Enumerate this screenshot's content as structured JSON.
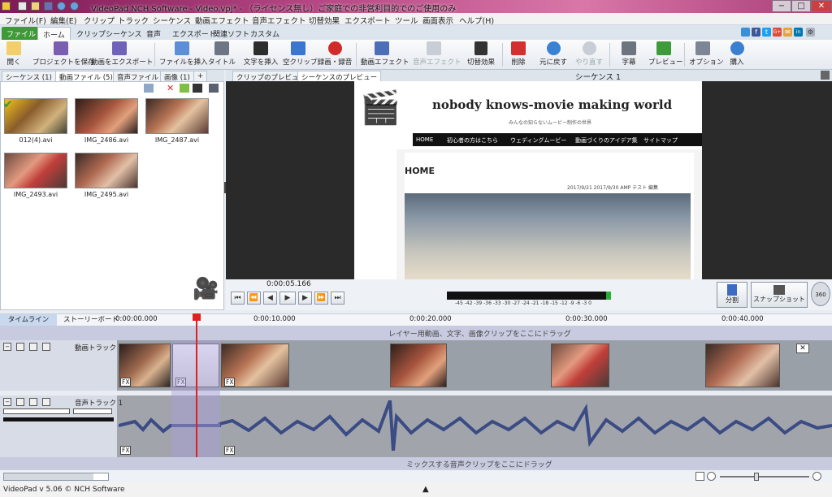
{
  "window": {
    "title": "VideoPad NCH Software - Video.vpj* - （ライセンス無し）ご家庭での非営利目的でのご使用のみ",
    "controls": [
      "−",
      "□",
      "✕"
    ]
  },
  "menu": [
    "ファイル(F)",
    "編集(E)",
    "クリップ",
    "トラック",
    "シーケンス",
    "動画エフェクト",
    "音声エフェクト",
    "切替効果",
    "エクスポート",
    "ツール",
    "画面表示",
    "ヘルプ(H)"
  ],
  "ribbon_tabs": [
    "ファイル",
    "ホーム",
    "クリップ",
    "シーケンス",
    "音声",
    "エクスポート",
    "関連ソフト",
    "カスタム"
  ],
  "social": [
    "f",
    "t",
    "G+",
    "✉",
    "in",
    "⚙"
  ],
  "toolbar": [
    "開く",
    "プロジェクトを保存",
    "動画をエクスポート",
    "ファイルを挿入",
    "タイトル",
    "文字を挿入",
    "空クリップ",
    "録画・録音",
    "動画エフェクト",
    "音声エフェクト",
    "切替効果",
    "削除",
    "元に戻す",
    "やり直す",
    "字幕",
    "プレビュー",
    "オプション",
    "購入"
  ],
  "colors": {
    "accent_green": "#3d9a37",
    "playhead": "#e02020",
    "waveform": "#3b4b84"
  },
  "bin": {
    "tabs": [
      {
        "label": "シーケンス",
        "count": "(1)"
      },
      {
        "label": "動画ファイル",
        "count": "(5)"
      },
      {
        "label": "音声ファイル",
        "count": ""
      },
      {
        "label": "画像",
        "count": "(1)"
      },
      {
        "label": "+",
        "count": ""
      }
    ],
    "files": [
      "012(4).avi",
      "IMG_2486.avi",
      "IMG_2487.avi",
      "IMG_2493.avi",
      "IMG_2495.avi"
    ]
  },
  "preview": {
    "tabs": [
      "クリップのプレビュー",
      "シーケンスのプレビュー"
    ],
    "sequence_title": "シーケンス 1",
    "time": "0:00:05.166",
    "meter_scale": "-45 -42 -39 -36 -33 -30 -27 -24 -21 -18 -15 -12 -9 -6 -3 0",
    "site_title": "nobody knows-movie making world",
    "site_tagline": "みんなの知らないムービー制作の世界",
    "nav": [
      "HOME",
      "初心者の方はこちら",
      "ウェディングムービー",
      "動画づくりのアイデア集",
      "サイトマップ"
    ],
    "heading": "HOME",
    "meta": "2017/9/21   2017/9/30   AMP  テスト  編集",
    "split_label": "分割",
    "snapshot_label": "スナップショット",
    "deg": "360"
  },
  "timeline": {
    "tabs": [
      "タイムライン",
      "ストーリーボード"
    ],
    "ruler": [
      "0:00:00.000",
      "0:00:10.000",
      "0:00:20.000",
      "0:00:30.000",
      "0:00:40.000"
    ],
    "overlay_hint": "レイヤー用動画、文字、画像クリップをここにドラッグ",
    "video_track": "動画トラック 1",
    "audio_track": "音声トラック 1",
    "mix_hint": "ミックスする音声クリップをここにドラッグ",
    "fx": "FX"
  },
  "status": "VideoPad v 5.06 © NCH Software"
}
